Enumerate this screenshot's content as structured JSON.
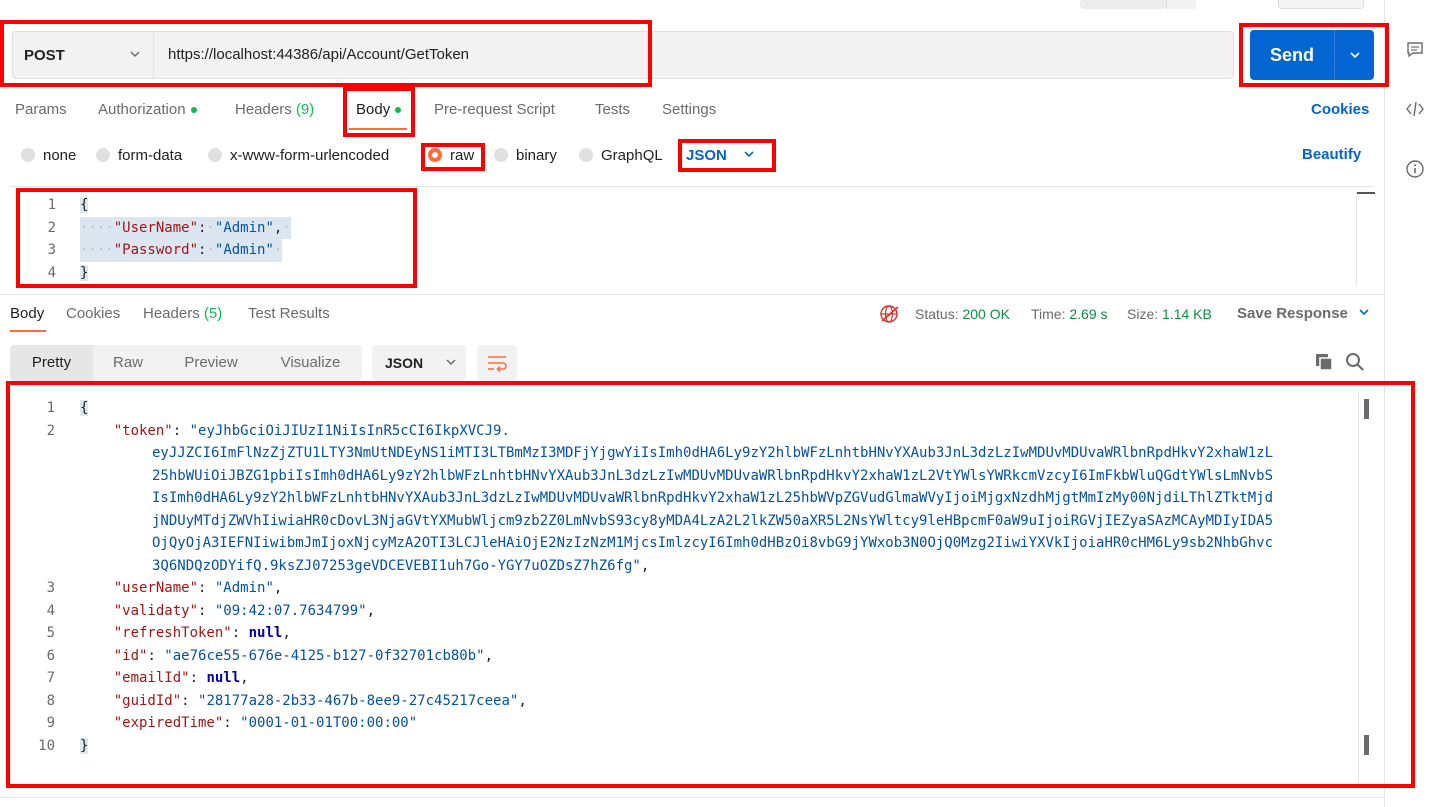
{
  "request": {
    "method": "POST",
    "url": "https://localhost:44386/api/Account/GetToken",
    "send_label": "Send"
  },
  "request_tabs": [
    {
      "label": "Params"
    },
    {
      "label": "Authorization"
    },
    {
      "label": "Headers",
      "count": "(9)"
    },
    {
      "label": "Body"
    },
    {
      "label": "Pre-request Script"
    },
    {
      "label": "Tests"
    },
    {
      "label": "Settings"
    }
  ],
  "cookies_link": "Cookies",
  "body_types": [
    "none",
    "form-data",
    "x-www-form-urlencoded",
    "raw",
    "binary",
    "GraphQL"
  ],
  "body_format": "JSON",
  "beautify_link": "Beautify",
  "request_body": {
    "line_numbers": [
      "1",
      "2",
      "3",
      "4"
    ],
    "open_brace": "{",
    "close_brace": "}",
    "lines": [
      {
        "key": "\"UserName\"",
        "value": "\"Admin\"",
        "trail": ","
      },
      {
        "key": "\"Password\"",
        "value": "\"Admin\"",
        "trail": ""
      }
    ]
  },
  "response_tabs": [
    {
      "label": "Body"
    },
    {
      "label": "Cookies"
    },
    {
      "label": "Headers",
      "count": "(5)"
    },
    {
      "label": "Test Results"
    }
  ],
  "response_meta": {
    "status_label": "Status:",
    "status_value": "200 OK",
    "time_label": "Time:",
    "time_value": "2.69 s",
    "size_label": "Size:",
    "size_value": "1.14 KB",
    "save_response": "Save Response"
  },
  "view_modes": [
    "Pretty",
    "Raw",
    "Preview",
    "Visualize"
  ],
  "response_format": "JSON",
  "response_body": {
    "line_numbers": [
      "1",
      "2",
      "3",
      "4",
      "5",
      "6",
      "7",
      "8",
      "9",
      "10"
    ],
    "open_brace": "{",
    "close_brace": "}",
    "token_key": "\"token\"",
    "token_lines": [
      "\"eyJhbGciOiJIUzI1NiIsInR5cCI6IkpXVCJ9.",
      "eyJJZCI6ImFlNzZjZTU1LTY3NmUtNDEyNS1iMTI3LTBmMzI3MDFjYjgwYiIsImh0dHA6Ly9zY2hlbWFzLnhtbHNvYXAub3JnL3dzLzIwMDUvMDUvaWRlbnRpdHkvY2xhaW1zL",
      "25hbWUiOiJBZG1pbiIsImh0dHA6Ly9zY2hlbWFzLnhtbHNvYXAub3JnL3dzLzIwMDUvMDUvaWRlbnRpdHkvY2xhaW1zL2VtYWlsYWRkcmVzcyI6ImFkbWluQGdtYWlsLmNvbS",
      "IsImh0dHA6Ly9zY2hlbWFzLnhtbHNvYXAub3JnL3dzLzIwMDUvMDUvaWRlbnRpdHkvY2xhaW1zL25hbWVpZGVudGlmaWVyIjoiMjgxNzdhMjgtMmIzMy00NjdiLThlZTktMjd",
      "jNDUyMTdjZWVhIiwiaHR0cDovL3NjaGVtYXMubWljcm9zb2Z0LmNvbS93cy8yMDA4LzA2L2lkZW50aXR5L2NsYWltcy9leHBpcmF0aW9uIjoiRGVjIEZyaSAzMCAyMDIyIDA5",
      "OjQyOjA3IEFNIiwibmJmIjoxNjcyMzA2OTI3LCJleHAiOjE2NzIzNzM1MjcsImlzcyI6Imh0dHBzOi8vbG9jYWxob3N0OjQ0Mzg2IiwiYXVkIjoiaHR0cHM6Ly9sb2NhbGhvc",
      "3Q6NDQzODYifQ.9ksZJ07253geVDCEVEBI1uh7Go-YGY7uOZDsZ7hZ6fg\""
    ],
    "fields": [
      {
        "key": "\"userName\"",
        "value": "\"Admin\"",
        "kind": "str"
      },
      {
        "key": "\"validaty\"",
        "value": "\"09:42:07.7634799\"",
        "kind": "str"
      },
      {
        "key": "\"refreshToken\"",
        "value": "null",
        "kind": "kw"
      },
      {
        "key": "\"id\"",
        "value": "\"ae76ce55-676e-4125-b127-0f32701cb80b\"",
        "kind": "str"
      },
      {
        "key": "\"emailId\"",
        "value": "null",
        "kind": "kw"
      },
      {
        "key": "\"guidId\"",
        "value": "\"28177a28-2b33-467b-8ee9-27c45217ceea\"",
        "kind": "str"
      },
      {
        "key": "\"expiredTime\"",
        "value": "\"0001-01-01T00:00:00\"",
        "kind": "str"
      }
    ]
  },
  "colors": {
    "accent_orange": "#ff6c37",
    "send_blue": "#0265d2",
    "success_green": "#0cbb52",
    "annotation_red": "#ff0000"
  },
  "icons": [
    "chevron-down-icon",
    "comment-icon",
    "code-icon",
    "info-icon",
    "globe-error-icon",
    "copy-icon",
    "search-icon",
    "wrap-lines-icon"
  ]
}
